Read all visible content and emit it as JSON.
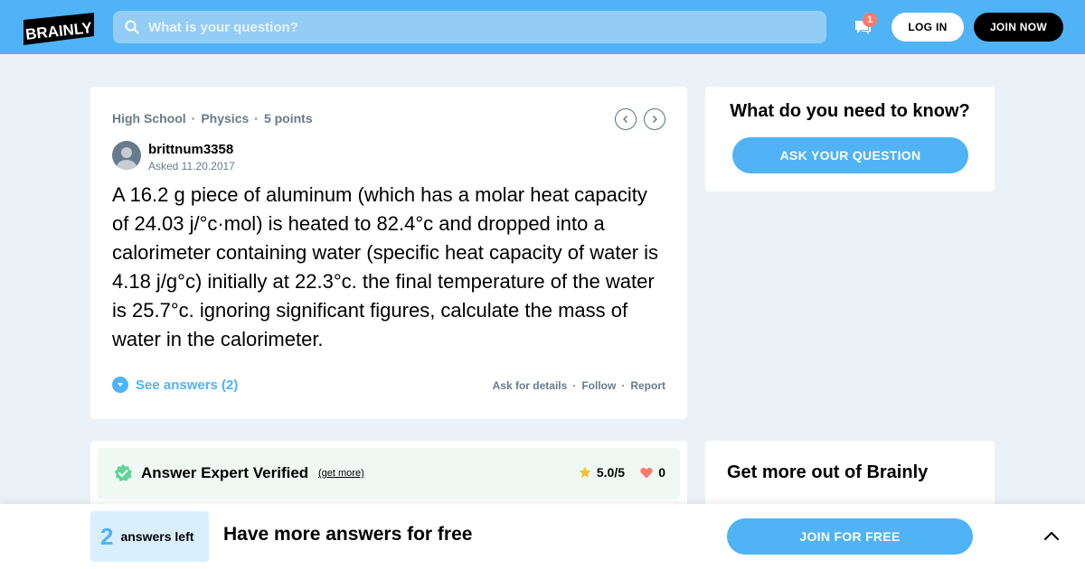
{
  "header": {
    "logo_text": "BRAINLY",
    "search": {
      "placeholder": "What is your question?"
    },
    "notifications_count": "1",
    "login_label": "LOG IN",
    "join_label": "JOIN NOW",
    "brand_color": "#4fb3f6"
  },
  "question": {
    "level": "High School",
    "subject": "Physics",
    "points": "5 points",
    "author": "brittnum3358",
    "asked": "Asked 11.20.2017",
    "text": "A 16.2 g piece of aluminum (which has a molar heat capacity of 24.03 j/°c·mol) is heated to 82.4°c and dropped into a calorimeter containing water (specific heat capacity of water is 4.18 j/g°c) initially at 22.3°c. the final temperature of the water is 25.7°c. ignoring significant figures, calculate the mass of water in the calorimeter.",
    "see_answers": "See answers (2)",
    "actions": {
      "ask_details": "Ask for details",
      "follow": "Follow",
      "report": "Report"
    },
    "separator": "·"
  },
  "sidebar": {
    "ask_title": "What do you need to know?",
    "ask_button": "ASK YOUR QUESTION",
    "more_title": "Get more out of Brainly"
  },
  "answer": {
    "verified_title": "Answer Expert Verified",
    "get_more": "(get more)",
    "rating": "5.0/5",
    "likes": "0"
  },
  "banner": {
    "answers_left_count": "2",
    "answers_left_label": "answers left",
    "message": "Have more answers for free",
    "join_free": "JOIN FOR FREE"
  },
  "icons": {
    "search": "search-icon",
    "messages": "messages-icon",
    "prev": "chevron-left-icon",
    "next": "chevron-right-icon",
    "expand": "chevron-down-icon",
    "verified": "verified-badge-icon",
    "star": "star-icon",
    "heart": "heart-icon",
    "collapse": "chevron-up-icon"
  }
}
